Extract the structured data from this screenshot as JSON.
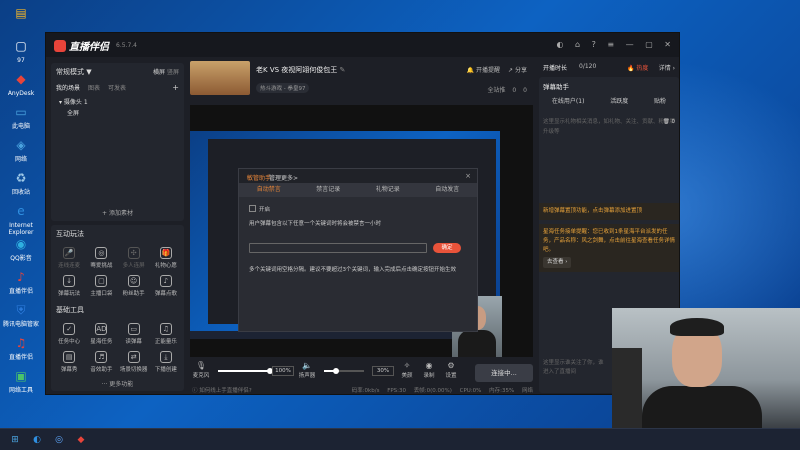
{
  "desktop_icons": [
    {
      "label": "",
      "glyph": "▤",
      "color": "#f0b429"
    },
    {
      "label": "97",
      "glyph": "▢",
      "color": "#ffffff"
    },
    {
      "label": "AnyDesk",
      "glyph": "◆",
      "color": "#e8443a"
    },
    {
      "label": "此电脑",
      "glyph": "▭",
      "color": "#4aa3df"
    },
    {
      "label": "网络",
      "glyph": "◈",
      "color": "#4aa3df"
    },
    {
      "label": "回收站",
      "glyph": "♻",
      "color": "#9ec9e8"
    },
    {
      "label": "Internet Explorer",
      "glyph": "e",
      "color": "#2f8fe0"
    },
    {
      "label": "QQ影音",
      "glyph": "◉",
      "color": "#2fb0e0"
    },
    {
      "label": "直播伴侣",
      "glyph": "♪",
      "color": "#e8443a"
    },
    {
      "label": "腾讯电脑管家",
      "glyph": "⛨",
      "color": "#2f7fe0"
    },
    {
      "label": "直播伴侣",
      "glyph": "♫",
      "color": "#e8443a"
    },
    {
      "label": "网络工具",
      "glyph": "▣",
      "color": "#4ac26b"
    }
  ],
  "app": {
    "name": "直播伴侣",
    "version": "6.5.7.4",
    "left": {
      "mode_label": "常规模式 ▼",
      "mode_links": [
        "横屏",
        "竖屏"
      ],
      "scenes_tabs": [
        "我的场景",
        "图表",
        "可发表"
      ],
      "add_icon": "+",
      "tree": [
        "▾ 摄像头 1",
        "全屏"
      ],
      "add_material": "+ 添加素材",
      "interactive_title": "互动玩法",
      "interactive": [
        {
          "label": "连线连麦",
          "glyph": "🎤",
          "dim": true
        },
        {
          "label": "骞爱挑战",
          "glyph": "◎",
          "dim": false
        },
        {
          "label": "多人连屏",
          "glyph": "✣",
          "dim": true
        },
        {
          "label": "礼物心愿",
          "glyph": "🎁",
          "dim": false
        },
        {
          "label": "弹幕玩法",
          "glyph": "↓",
          "dim": false
        },
        {
          "label": "主播口袋",
          "glyph": "▢",
          "dim": false
        },
        {
          "label": "粉丝助手",
          "glyph": "☺",
          "dim": false
        },
        {
          "label": "弹幕点歌",
          "glyph": "♪",
          "dim": false
        }
      ],
      "basic_title": "基础工具",
      "basic": [
        {
          "label": "任务中心",
          "glyph": "✓"
        },
        {
          "label": "星海任务",
          "glyph": "AD"
        },
        {
          "label": "读弹幕",
          "glyph": "▭"
        },
        {
          "label": "正能量乐",
          "glyph": "♫"
        },
        {
          "label": "弹幕秀",
          "glyph": "▤"
        },
        {
          "label": "音效助手",
          "glyph": "♬"
        },
        {
          "label": "场景切换器",
          "glyph": "⇄"
        },
        {
          "label": "下播创建",
          "glyph": "⤓"
        }
      ],
      "more": "··· 更多功能"
    },
    "center": {
      "title": "老K VS  夜视阿翊何俊包王",
      "category": "热斗游戏 - 拳皇97",
      "links": [
        "开播提醒",
        "分享"
      ],
      "stats": [
        "全站推",
        "0",
        "0"
      ],
      "dialog": {
        "tab_active": "敏管助手",
        "tab_other": "管理更多>",
        "close": "×",
        "tabs": [
          "自动禁言",
          "禁言记录",
          "礼物记录",
          "自动发言"
        ],
        "enable_label": "开启",
        "rule_text": "用户弹幕包含以下任意一个关键词时将会被禁言一小时",
        "input_value": "",
        "confirm": "确定",
        "help": "多个关键词用空格分隔。建议不要超过3个关键词，输入完成后点击确定按钮开始生效"
      },
      "controls": {
        "mic_label": "麦克风",
        "mic_pct": "100%",
        "mic_value": 1.0,
        "speaker_label": "扬声器",
        "speaker_pct": "30%",
        "speaker_value": 0.3,
        "buttons": [
          {
            "label": "美颜",
            "glyph": "✧"
          },
          {
            "label": "录制",
            "glyph": "◉"
          },
          {
            "label": "设置",
            "glyph": "⚙"
          }
        ],
        "connect": "连接中..."
      },
      "status": {
        "left": "ⓘ 如何线上手直播伴侣?",
        "right": [
          "码率:0kb/s",
          "FPS:30",
          "丢帧:0(0.00%)",
          "CPU:0%",
          "内存:35%",
          "网络"
        ]
      }
    },
    "right": {
      "ticker": {
        "a": "开播时长",
        "b": "0/120",
        "c": "热度",
        "d": "详情 ›"
      },
      "helper_title": "弹幕助手",
      "tabs": [
        "在线用户(1)",
        "活跃度",
        "贴粉"
      ],
      "count": "0",
      "msg_placeholder": "这里显示礼物相关消息，如礼物、关注、贡献、粉丝牌升级等",
      "notice1": "新增弹幕置顶功能，点击弹幕添加进置顶",
      "notice2": "星海任务接单提醒：您已收到1条星海平台派发的任务，产品名称：风之剑舞，点击前往星海查看任务详情吧。",
      "goto": "去查看 ›",
      "bottom_placeholder": "这里显示谁关注了你，谁进入了直播间"
    }
  },
  "taskbar": [
    "⊞",
    "◐",
    "◎",
    "◆"
  ]
}
